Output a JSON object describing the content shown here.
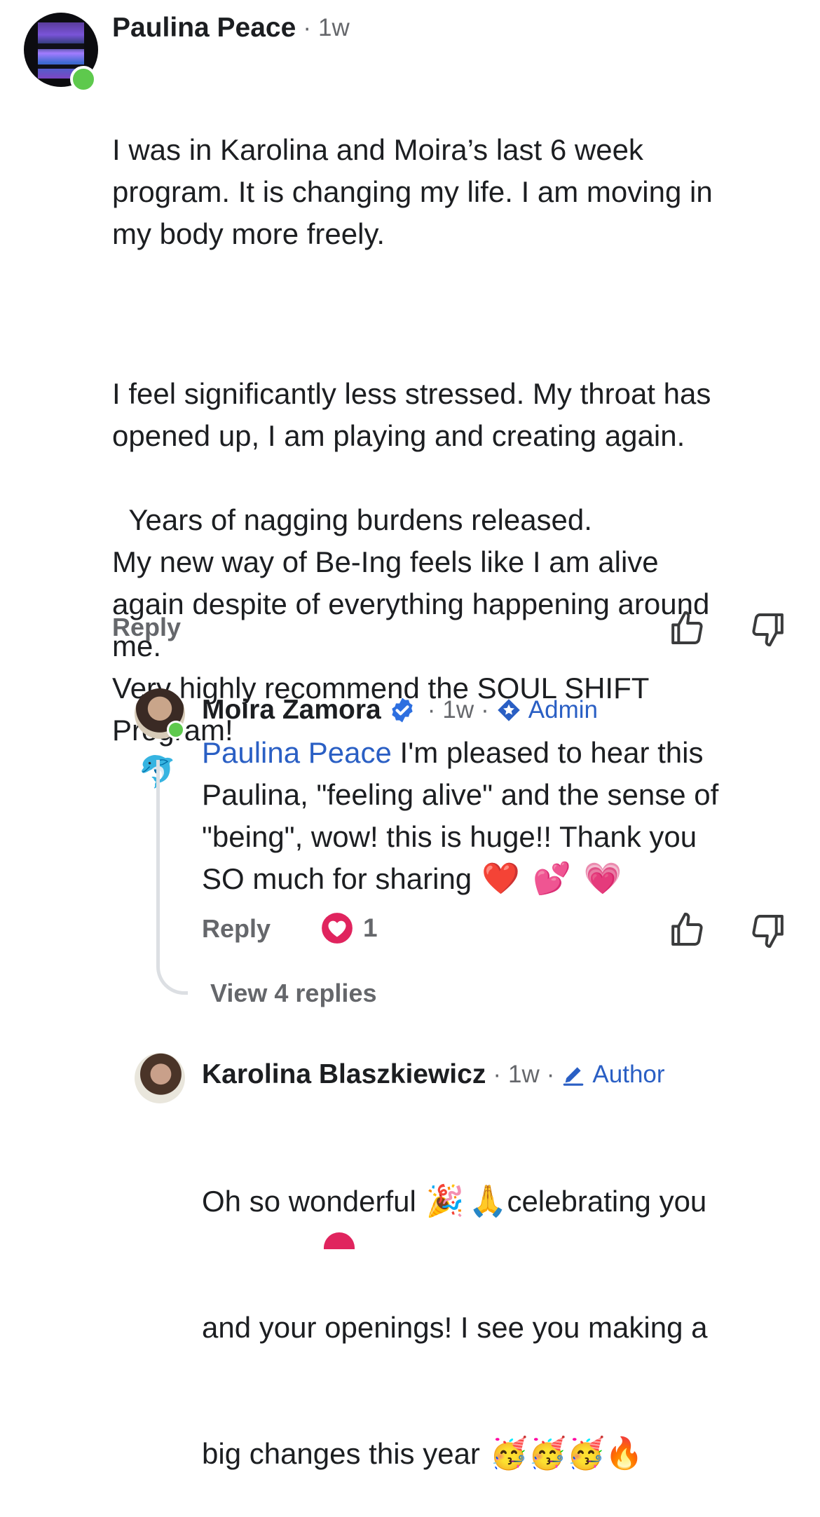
{
  "comments": [
    {
      "author": "Paulina Peace",
      "time": "1w",
      "paragraphs": [
        "I was in Karolina and Moira’s last 6 week\nprogram. It is changing my life. I am moving in\nmy body more freely.",
        "I feel significantly less stressed. My throat has\nopened up, I am playing and creating again.",
        "Years of nagging burdens released.\nMy new way of Be-Ing feels like I am alive\nagain despite of everything happening around\nme.\nVery highly recommend the SOUL SHIFT\nProgram!"
      ],
      "trailing_emoji": "🐬",
      "reply_label": "Reply"
    },
    {
      "author": "Moira Zamora",
      "verified": true,
      "time": "1w",
      "badge": "Admin",
      "mention": "Paulina Peace",
      "text": " I'm pleased to hear this\nPaulina, \"feeling alive\" and the sense of\n\"being\", wow! this is huge!! Thank you\nSO much for sharing",
      "emojis": [
        "❤️",
        "💕",
        "💗"
      ],
      "reply_label": "Reply",
      "reaction_count": "1",
      "view_replies": "View 4 replies"
    },
    {
      "author": "Karolina Blaszkiewicz",
      "time": "1w",
      "badge": "Author",
      "line1": "Oh so wonderful",
      "line1_emojis": [
        "🎉",
        "🙏"
      ],
      "line1_rest": "celebrating you",
      "line2": "and your openings! I see you making a",
      "line3": "big changes this year",
      "line3_emojis": [
        "🥳",
        "🥳",
        "🥳",
        "🔥"
      ]
    }
  ],
  "separator": "·",
  "icons": [
    "like-icon",
    "dislike-icon",
    "verified-icon",
    "admin-icon",
    "author-icon",
    "heart-reaction-icon"
  ],
  "colors": {
    "link": "#2a5fc4",
    "online": "#5ec94d",
    "meta": "#65676b",
    "heart": "#e0245e"
  }
}
